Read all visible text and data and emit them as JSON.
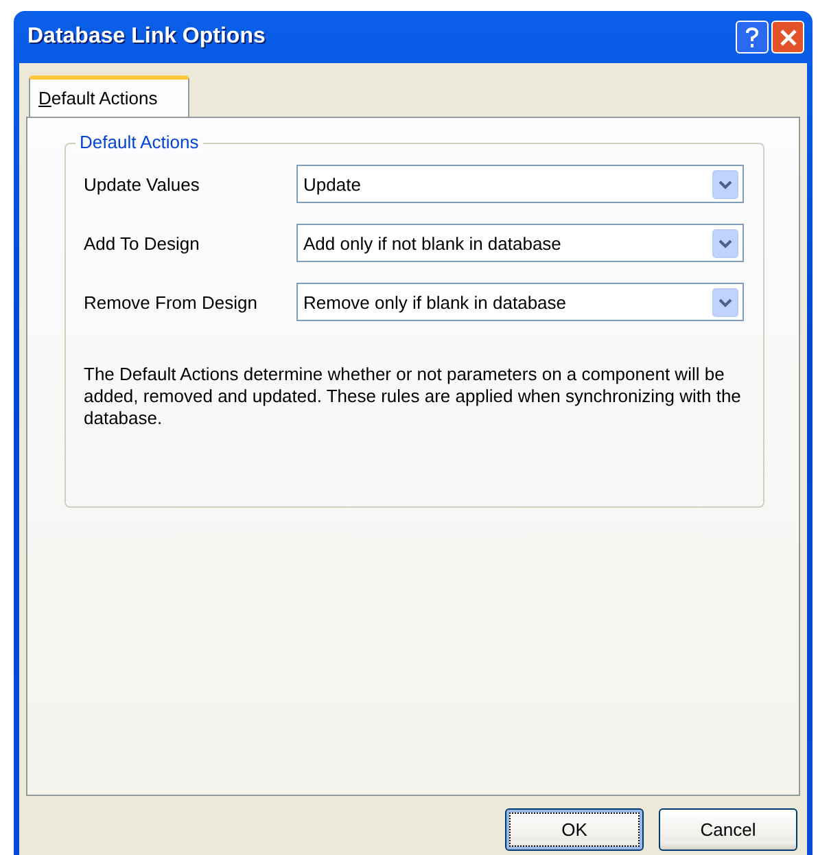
{
  "window": {
    "title": "Database Link Options"
  },
  "tabs": [
    {
      "label": "Default Actions",
      "selected": true
    }
  ],
  "group": {
    "title": "Default Actions",
    "fields": [
      {
        "label": "Update Values",
        "value": "Update"
      },
      {
        "label": "Add To Design",
        "value": "Add only if not blank in database"
      },
      {
        "label": "Remove From Design",
        "value": "Remove only if blank in database"
      }
    ],
    "description": "The Default Actions determine whether or not parameters on a component will be added, removed and updated. These rules are applied when synchronizing with the database."
  },
  "buttons": [
    {
      "label": "OK",
      "default": true
    },
    {
      "label": "Cancel",
      "default": false
    }
  ]
}
